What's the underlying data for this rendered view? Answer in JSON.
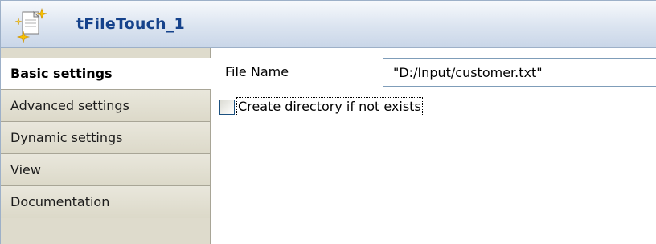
{
  "header": {
    "icon": "touch-file-icon",
    "title": "tFileTouch_1"
  },
  "sidebar": {
    "items": [
      {
        "label": "Basic settings",
        "active": true
      },
      {
        "label": "Advanced settings",
        "active": false
      },
      {
        "label": "Dynamic settings",
        "active": false
      },
      {
        "label": "View",
        "active": false
      },
      {
        "label": "Documentation",
        "active": false
      }
    ]
  },
  "main": {
    "file_name_label": "File Name",
    "file_name_value": "\"D:/Input/customer.txt\"",
    "create_dir_label": "Create directory if not exists",
    "create_dir_checked": false
  },
  "colors": {
    "title": "#15428b",
    "sidebar_bg": "#dedbcc",
    "header_bg": "#dbe4f0"
  }
}
